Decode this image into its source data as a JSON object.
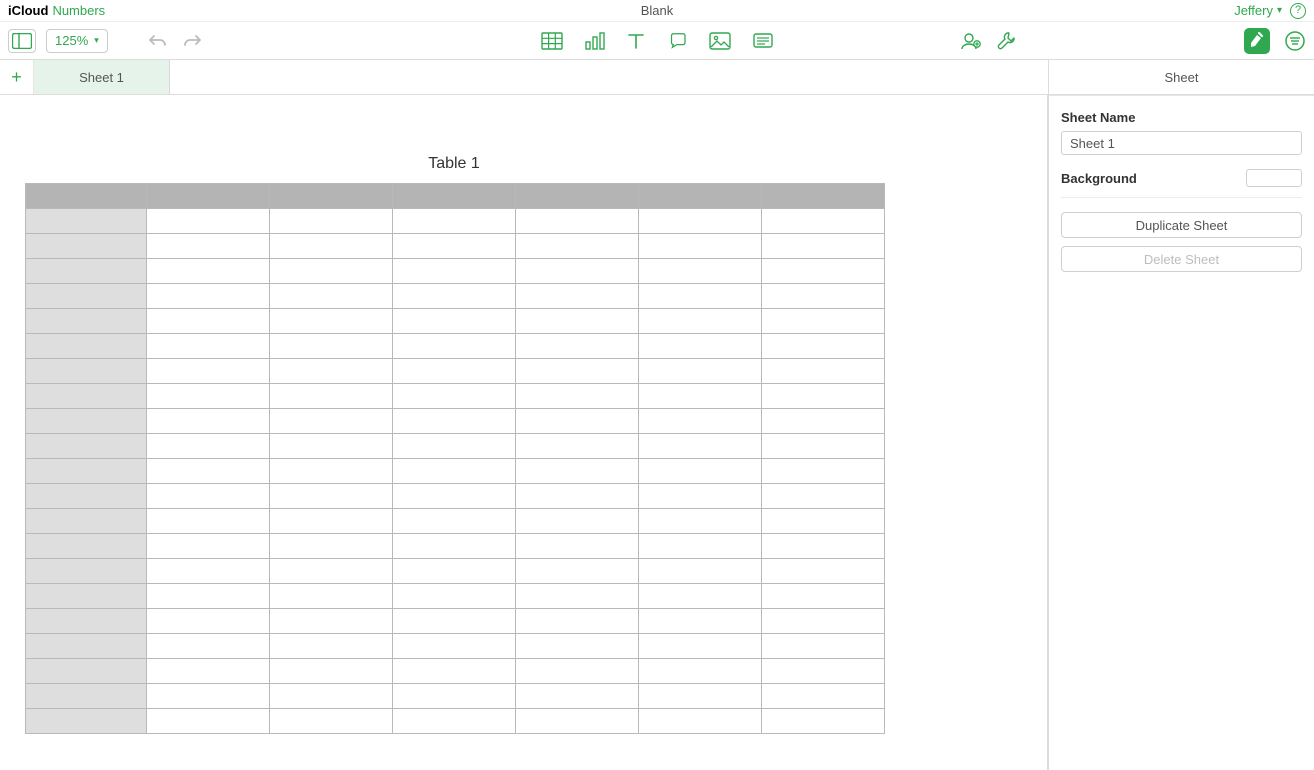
{
  "titlebar": {
    "brand": "iCloud",
    "app": "Numbers",
    "document": "Blank",
    "user": "Jeffery"
  },
  "toolbar": {
    "zoom": "125%"
  },
  "tabs": {
    "active": "Sheet 1"
  },
  "table": {
    "title": "Table 1",
    "columns": 7,
    "rows": 22
  },
  "inspector": {
    "header": "Sheet",
    "sheet_name_label": "Sheet Name",
    "sheet_name_value": "Sheet 1",
    "background_label": "Background",
    "duplicate_label": "Duplicate Sheet",
    "delete_label": "Delete Sheet"
  }
}
